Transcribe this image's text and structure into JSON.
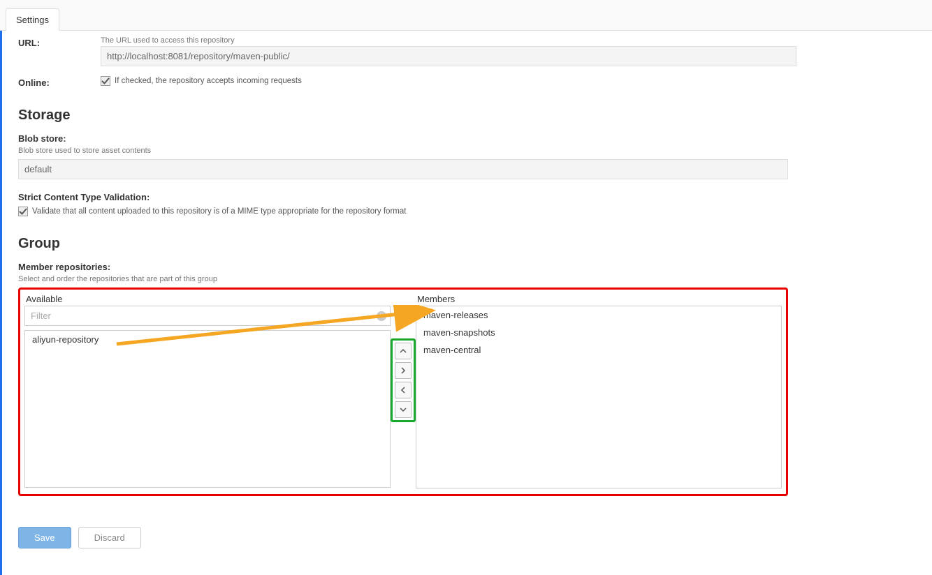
{
  "tab": {
    "label": "Settings"
  },
  "url": {
    "label": "URL:",
    "hint": "The URL used to access this repository",
    "value": "http://localhost:8081/repository/maven-public/"
  },
  "online": {
    "label": "Online:",
    "checked": true,
    "hint": "If checked, the repository accepts incoming requests"
  },
  "storage": {
    "heading": "Storage",
    "blob_label": "Blob store:",
    "blob_hint": "Blob store used to store asset contents",
    "blob_value": "default",
    "strict_label": "Strict Content Type Validation:",
    "strict_checked": true,
    "strict_hint": "Validate that all content uploaded to this repository is of a MIME type appropriate for the repository format"
  },
  "group": {
    "heading": "Group",
    "member_label": "Member repositories:",
    "member_hint": "Select and order the repositories that are part of this group",
    "available_title": "Available",
    "members_title": "Members",
    "filter_placeholder": "Filter",
    "available": [
      "aliyun-repository"
    ],
    "members": [
      "maven-releases",
      "maven-snapshots",
      "maven-central"
    ]
  },
  "buttons": {
    "save": "Save",
    "discard": "Discard"
  }
}
